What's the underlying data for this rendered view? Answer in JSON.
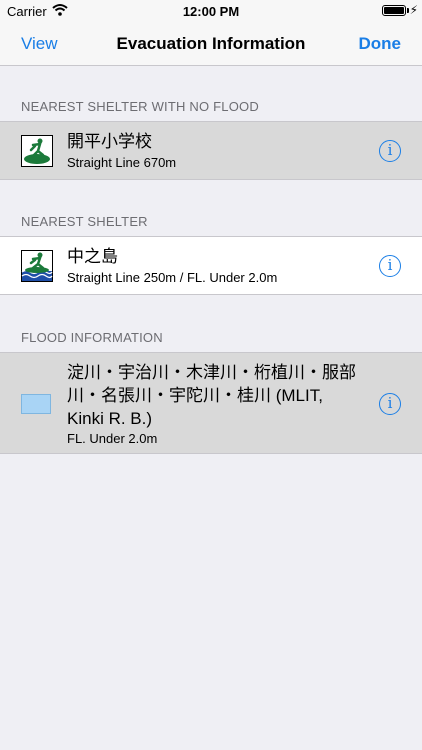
{
  "status_bar": {
    "carrier": "Carrier",
    "time": "12:00 PM"
  },
  "nav": {
    "left": "View",
    "title": "Evacuation Information",
    "right": "Done"
  },
  "sections": [
    {
      "header": "NEAREST SHELTER WITH NO FLOOD",
      "item": {
        "title": "開平小学校",
        "subtitle": "Straight Line 670m"
      }
    },
    {
      "header": "NEAREST SHELTER",
      "item": {
        "title": "中之島",
        "subtitle": "Straight Line 250m / FL. Under 2.0m"
      }
    },
    {
      "header": "FLOOD INFORMATION",
      "item": {
        "title_lines": [
          "淀川・宇治川・木津川・桁植川・服部",
          "川・名張川・宇陀川・桂川 (MLIT,",
          "Kinki R. B.)"
        ],
        "subtitle": "FL. Under 2.0m",
        "swatch_color": "#a9d4f5"
      }
    }
  ],
  "info_glyph": "i",
  "colors": {
    "accent": "#1a7ee6",
    "background": "#efeff4",
    "selected": "#d9d9d9",
    "shelter_green": "#1b7a3a"
  }
}
